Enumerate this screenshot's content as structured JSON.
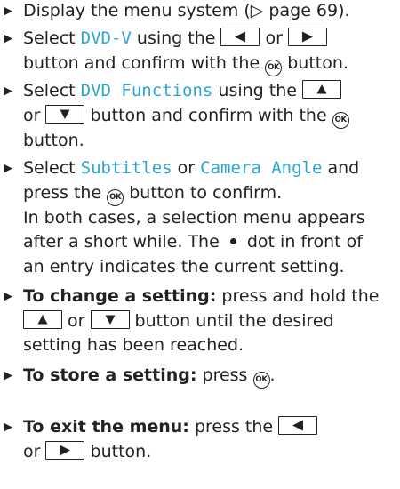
{
  "steps": [
    {
      "a": "Display the menu system (",
      "b": "▷",
      "c": " page 69)."
    },
    {
      "a": "Select ",
      "mono": "DVD-V",
      "b": " using the ",
      "c": " or ",
      "d": "button and confirm with the ",
      "e": " button."
    },
    {
      "a": "Select ",
      "mono": "DVD Functions",
      "b": " using the ",
      "c": "or ",
      "d": " button and confirm with the ",
      "e": "button."
    },
    {
      "a": "Select ",
      "mono1": "Subtitles",
      "b": " or ",
      "mono2": "Camera Angle",
      "c": " and",
      "d": "press the ",
      "e": " button to confirm.",
      "f": "In both cases, a selection menu appears",
      "g": "after a short while. The ",
      "h": " dot in front of",
      "i": "an entry indicates the current setting."
    },
    {
      "bold": "To change a setting:",
      "a": " press and hold the",
      "b": " or ",
      "c": " button until the desired",
      "d": "setting has been reached."
    },
    {
      "bold": "To store a setting:",
      "a": " press ",
      "b": "."
    },
    {
      "bold": "To exit the menu:",
      "a": " press the ",
      "b": "or ",
      "c": " button."
    }
  ],
  "ok_label": "OK",
  "step_marker": "▶",
  "link_color": "#2aa6d6"
}
